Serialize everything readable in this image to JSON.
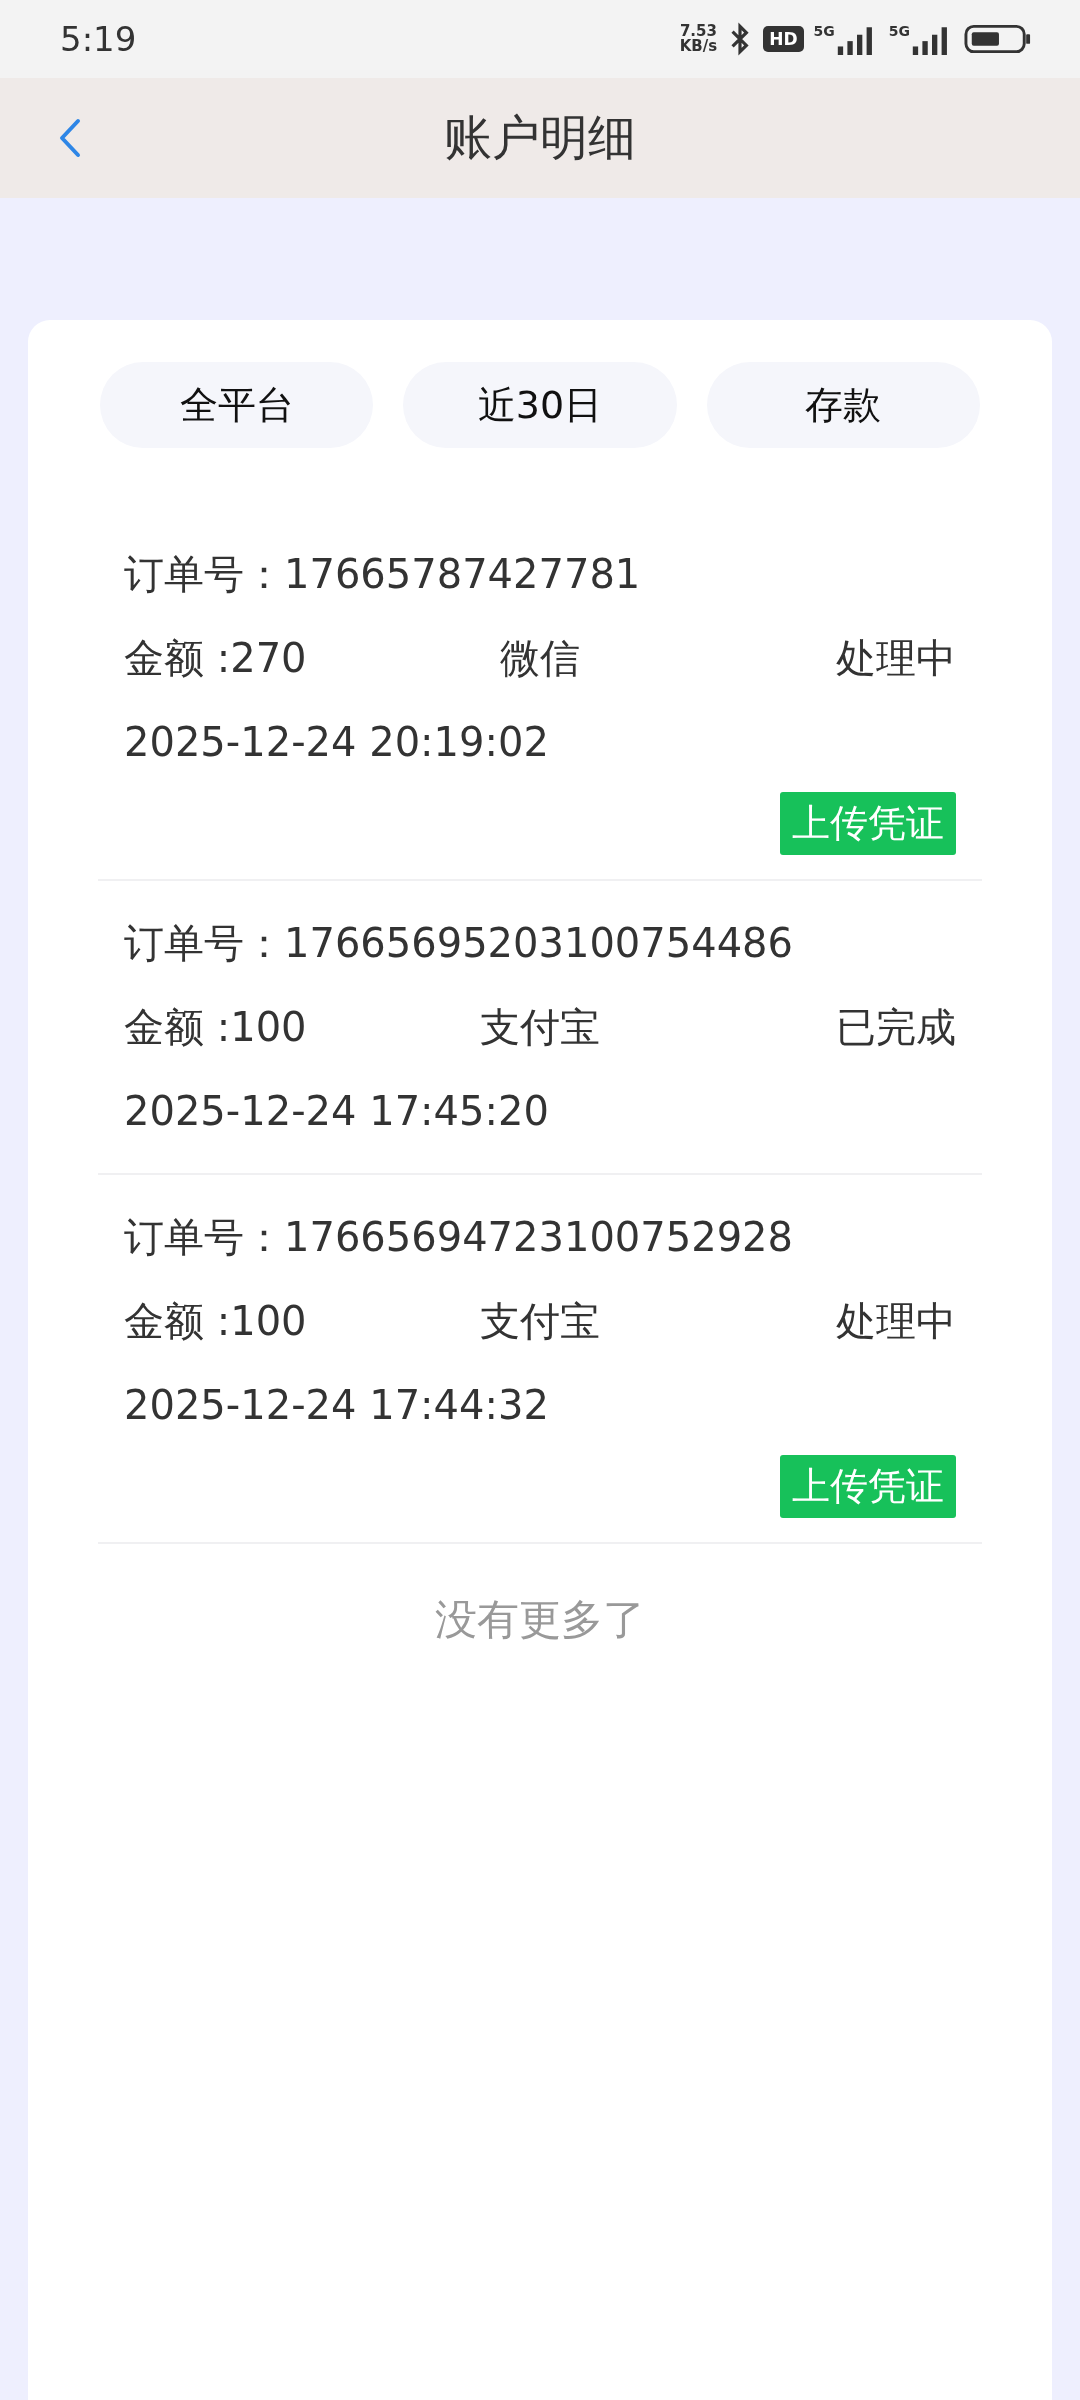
{
  "status_bar": {
    "time": "5:19",
    "net_speed": "7.53",
    "net_unit": "KB/s",
    "hd_label": "HD",
    "sim_1": "5G",
    "sim_2": "5G"
  },
  "header": {
    "title": "账户明细"
  },
  "filters": [
    {
      "label": "全平台"
    },
    {
      "label": "近30日"
    },
    {
      "label": "存款"
    }
  ],
  "orders": [
    {
      "order_label": "订单号：",
      "order_no": "17665787427781",
      "amount": "金额 :270",
      "method": "微信",
      "status": "处理中",
      "time": "2025-12-24 20:19:02",
      "action": "上传凭证"
    },
    {
      "order_label": "订单号：",
      "order_no": "17665695203100754486",
      "amount": "金额 :100",
      "method": "支付宝",
      "status": "已完成",
      "time": "2025-12-24 17:45:20"
    },
    {
      "order_label": "订单号：",
      "order_no": "17665694723100752928",
      "amount": "金额 :100",
      "method": "支付宝",
      "status": "处理中",
      "time": "2025-12-24 17:44:32",
      "action": "上传凭证"
    }
  ],
  "end_note": "没有更多了"
}
